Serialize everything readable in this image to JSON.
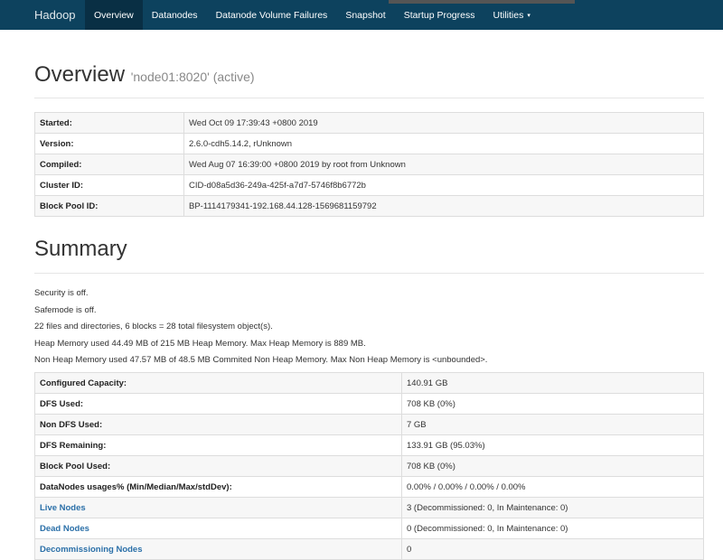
{
  "navbar": {
    "brand": "Hadoop",
    "items": [
      {
        "label": "Overview",
        "active": true
      },
      {
        "label": "Datanodes",
        "active": false
      },
      {
        "label": "Datanode Volume Failures",
        "active": false
      },
      {
        "label": "Snapshot",
        "active": false
      },
      {
        "label": "Startup Progress",
        "active": false
      },
      {
        "label": "Utilities",
        "active": false,
        "dropdown": true
      }
    ],
    "dropdown_caret": "▾"
  },
  "overview": {
    "title": "Overview",
    "subtitle": "'node01:8020' (active)",
    "rows": [
      {
        "key": "Started:",
        "value": "Wed Oct 09 17:39:43 +0800 2019"
      },
      {
        "key": "Version:",
        "value": "2.6.0-cdh5.14.2, rUnknown"
      },
      {
        "key": "Compiled:",
        "value": "Wed Aug 07 16:39:00 +0800 2019 by root from Unknown"
      },
      {
        "key": "Cluster ID:",
        "value": "CID-d08a5d36-249a-425f-a7d7-5746f8b6772b"
      },
      {
        "key": "Block Pool ID:",
        "value": "BP-1114179341-192.168.44.128-1569681159792"
      }
    ]
  },
  "summary": {
    "title": "Summary",
    "lines": [
      "Security is off.",
      "Safemode is off.",
      "22 files and directories, 6 blocks = 28 total filesystem object(s).",
      "Heap Memory used 44.49 MB of 215 MB Heap Memory. Max Heap Memory is 889 MB.",
      "Non Heap Memory used 47.57 MB of 48.5 MB Commited Non Heap Memory. Max Non Heap Memory is <unbounded>."
    ],
    "rows": [
      {
        "key": "Configured Capacity:",
        "value": "140.91 GB",
        "link": false
      },
      {
        "key": "DFS Used:",
        "value": "708 KB (0%)",
        "link": false
      },
      {
        "key": "Non DFS Used:",
        "value": "7 GB",
        "link": false
      },
      {
        "key": "DFS Remaining:",
        "value": "133.91 GB (95.03%)",
        "link": false
      },
      {
        "key": "Block Pool Used:",
        "value": "708 KB (0%)",
        "link": false
      },
      {
        "key": "DataNodes usages% (Min/Median/Max/stdDev):",
        "value": "0.00% / 0.00% / 0.00% / 0.00%",
        "link": false
      },
      {
        "key": "Live Nodes",
        "value": "3 (Decommissioned: 0, In Maintenance: 0)",
        "link": true
      },
      {
        "key": "Dead Nodes",
        "value": "0 (Decommissioned: 0, In Maintenance: 0)",
        "link": true
      },
      {
        "key": "Decommissioning Nodes",
        "value": "0",
        "link": true
      }
    ]
  }
}
